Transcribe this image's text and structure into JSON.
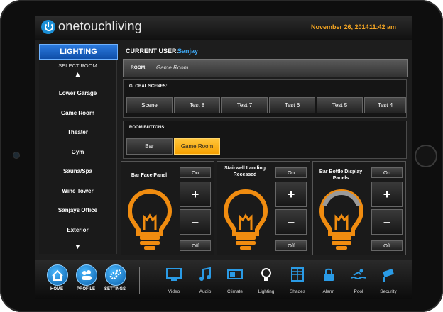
{
  "header": {
    "brand": "onetouchliving",
    "date": "November 26, 2014",
    "time": "11:42 am"
  },
  "section_tab": "LIGHTING",
  "current_user": {
    "label": "CURRENT USER:",
    "name": "Sanjay"
  },
  "sidebar": {
    "title": "SELECT ROOM",
    "up_arrow": "▲",
    "down_arrow": "▼",
    "rooms": [
      "Lower Garage",
      "Game Room",
      "Theater",
      "Gym",
      "Sauna/Spa",
      "Wine Tower",
      "Sanjays Office",
      "Exterior"
    ]
  },
  "room": {
    "label": "ROOM:",
    "value": "Game Room"
  },
  "global_scenes": {
    "label": "GLOBAL SCENES:",
    "items": [
      "Scene",
      "Test 8",
      "Test 7",
      "Test 6",
      "Test 5",
      "Test 4"
    ]
  },
  "room_buttons": {
    "label": "ROOM BUTTONS:",
    "items": [
      "Bar",
      "Game Room"
    ],
    "active": "Game Room"
  },
  "lights": [
    {
      "name": "Bar Face Panel",
      "on": "On",
      "up": "+",
      "down": "–",
      "off": "Off",
      "level": 0.0
    },
    {
      "name": "Stairwell Landing Recessed",
      "on": "On",
      "up": "+",
      "down": "–",
      "off": "Off",
      "level": 0.0
    },
    {
      "name": "Bar Bottle Display Panels",
      "on": "On",
      "up": "+",
      "down": "–",
      "off": "Off",
      "level": 1.0
    }
  ],
  "nav": [
    {
      "label": "HOME",
      "icon": "home-icon"
    },
    {
      "label": "PROFILE",
      "icon": "profile-icon"
    },
    {
      "label": "SETTINGS",
      "icon": "gears-icon"
    }
  ],
  "devices": [
    {
      "label": "Video",
      "icon": "tv-icon"
    },
    {
      "label": "Audio",
      "icon": "music-note-icon"
    },
    {
      "label": "Climate",
      "icon": "thermostat-icon"
    },
    {
      "label": "Lighting",
      "icon": "bulb-icon"
    },
    {
      "label": "Shades",
      "icon": "shades-icon"
    },
    {
      "label": "Alarm",
      "icon": "lock-icon"
    },
    {
      "label": "Pool",
      "icon": "swimmer-icon"
    },
    {
      "label": "Security",
      "icon": "camera-icon"
    }
  ],
  "colors": {
    "accent": "#f5a623",
    "blue": "#1b8fd6",
    "bulb_on": "#f08c10",
    "bulb_off": "#8a8a8a"
  }
}
